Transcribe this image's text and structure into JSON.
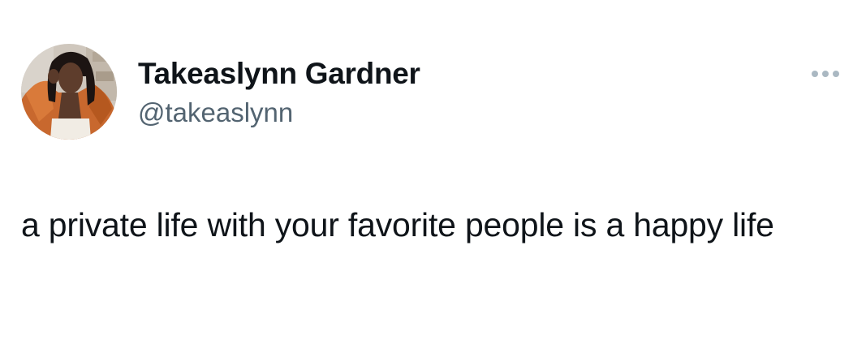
{
  "author": {
    "display_name": "Takeaslynn Gardner",
    "handle": "@takeaslynn",
    "avatar_icon": "profile-photo"
  },
  "more_icon": "more-horizontal-icon",
  "tweet": {
    "text": "a private life with your favorite people is a happy life"
  },
  "colors": {
    "text_primary": "#0f1419",
    "text_secondary": "#536471",
    "icon_muted": "#aab8c2",
    "background": "#ffffff"
  }
}
